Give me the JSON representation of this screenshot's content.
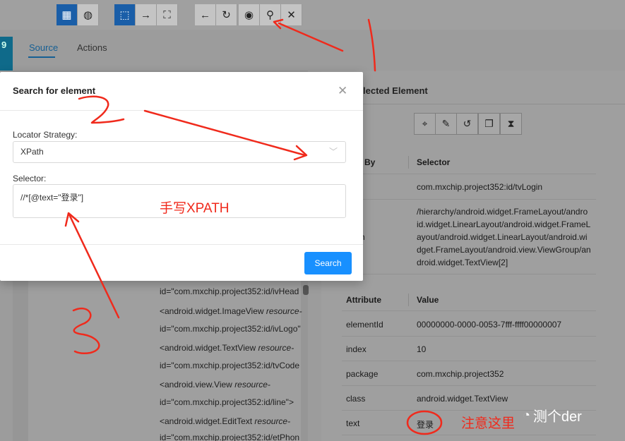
{
  "toolbar": {
    "buttons": [
      "grid-icon",
      "globe-icon",
      "select-icon",
      "swipe-icon",
      "tap-by-coord-icon",
      "back-icon",
      "refresh-icon",
      "eye-icon",
      "search-icon",
      "close-icon"
    ]
  },
  "left_strip_text": "9",
  "tabs": [
    {
      "label": "Source",
      "active": true
    },
    {
      "label": "Actions",
      "active": false
    }
  ],
  "xml": {
    "lines": [
      {
        "pre": "",
        "italic": "",
        "post": "id=\"com.mxchip.project352:id/ivHead"
      },
      {
        "pre": "<android.widget.ImageView ",
        "italic": "resource-",
        "post": ""
      },
      {
        "pre": "",
        "italic": "",
        "post": "id=\"com.mxchip.project352:id/ivLogo\""
      },
      {
        "pre": "<android.widget.TextView ",
        "italic": "resource-",
        "post": ""
      },
      {
        "pre": "",
        "italic": "",
        "post": "id=\"com.mxchip.project352:id/tvCode"
      },
      {
        "pre": "<android.view.View ",
        "italic": "resource-",
        "post": ""
      },
      {
        "pre": "",
        "italic": "",
        "post": "id=\"com.mxchip.project352:id/line\">"
      },
      {
        "pre": "<android.widget.EditText ",
        "italic": "resource-",
        "post": ""
      },
      {
        "pre": "",
        "italic": "",
        "post": "id=\"com.mxchip.project352:id/etPhon"
      }
    ]
  },
  "selected": {
    "title": "lected Element",
    "find_by_header": "By",
    "selector_header": "Selector",
    "selectors": [
      {
        "by": "",
        "value_lines": [
          "com.mxchip.project352:id/tvLogin"
        ]
      },
      {
        "by": "h",
        "value_lines": [
          "/hierarchy/android.widget.FrameLayout/andro",
          "id.widget.LinearLayout/android.widget.FrameL",
          "ayout/android.widget.LinearLayout/android.wi",
          "dget.FrameLayout/android.view.ViewGroup/an",
          "droid.widget.TextView[2]"
        ]
      }
    ],
    "attr_header": "Attribute",
    "value_header": "Value",
    "attributes": [
      {
        "name": "elementId",
        "value": "00000000-0000-0053-7fff-ffff00000007"
      },
      {
        "name": "index",
        "value": "10"
      },
      {
        "name": "package",
        "value": "com.mxchip.project352"
      },
      {
        "name": "class",
        "value": "android.widget.TextView"
      },
      {
        "name": "text",
        "value": "登录"
      }
    ]
  },
  "modal": {
    "title": "Search for element",
    "locator_label": "Locator Strategy:",
    "locator_value": "XPath",
    "selector_label": "Selector:",
    "selector_value": "//*[@text=\"登录\"]",
    "search_button": "Search"
  },
  "annotations": {
    "handwritten_xpath": "手写XPATH",
    "note_here": "注意这里"
  },
  "watermark": "测个der",
  "colors": {
    "accent": "#1890ff",
    "annotation": "#f02a1c",
    "toolbar_active": "#1a5ea8"
  }
}
